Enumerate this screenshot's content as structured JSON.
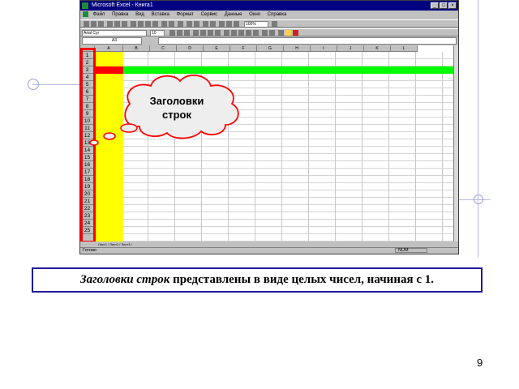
{
  "window": {
    "title": "Microsoft Excel - Книга1",
    "menu": [
      "Файл",
      "Правка",
      "Вид",
      "Вставка",
      "Формат",
      "Сервис",
      "Данные",
      "Окно",
      "Справка"
    ],
    "font_name": "Arial Cyr",
    "font_size": "10",
    "zoom": "100%",
    "name_box": "A3",
    "columns": [
      "A",
      "B",
      "C",
      "D",
      "E",
      "F",
      "G",
      "H",
      "I",
      "J",
      "K",
      "L"
    ],
    "rows": [
      "1",
      "2",
      "3",
      "4",
      "5",
      "6",
      "7",
      "8",
      "9",
      "10",
      "11",
      "12",
      "13",
      "14",
      "15",
      "16",
      "17",
      "18",
      "19",
      "20",
      "21",
      "22",
      "23",
      "24",
      "25"
    ],
    "sheet_tabs": "Лист1 / Лист2 / Лист3 /",
    "status_ready": "Готово",
    "status_num": "NUM"
  },
  "colors": {
    "highlight_column": "#ffff00",
    "highlight_row": "#00ff00",
    "frame": "#ff0000",
    "caption_border": "#1a1a9a"
  },
  "callout": {
    "line1": "Заголовки",
    "line2": "строк"
  },
  "caption": {
    "emphasis": "Заголовки строк",
    "rest": " представлены в виде целых чисел, начиная с 1."
  },
  "page_number": "9"
}
